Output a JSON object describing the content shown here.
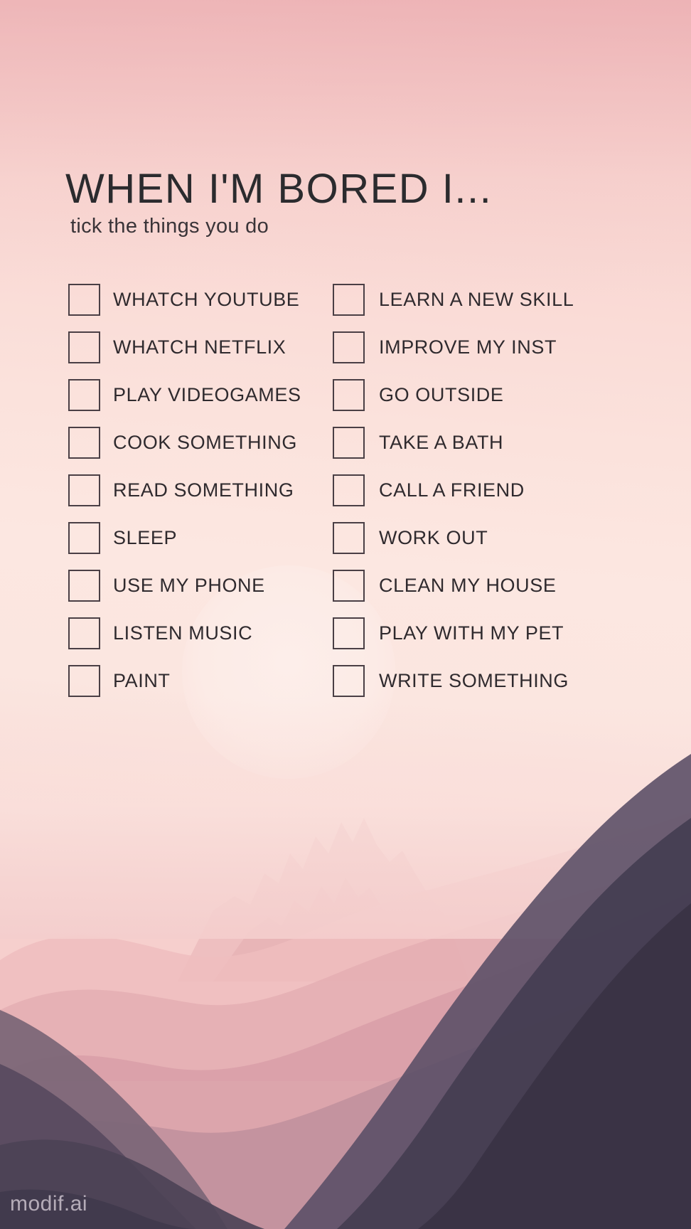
{
  "poster": {
    "title": "WHEN I'M BORED I...",
    "subtitle": "tick the things you do",
    "watermark": "modif.ai"
  },
  "colors": {
    "background_top": "#f3c4c4",
    "background_mid": "#fce7e1",
    "mountain_far": "#f0c4c4",
    "mountain_mid": "#d9a6ad",
    "mountain_near": "#6e5c6e",
    "mountain_dark": "#3b3546",
    "text": "#2f2a2e",
    "checkbox_border": "#4a3f45",
    "watermark": "#e2d8e2"
  },
  "checklist": {
    "left_column": [
      {
        "label": "WHATCH YOUTUBE",
        "checked": false
      },
      {
        "label": "WHATCH NETFLIX",
        "checked": false
      },
      {
        "label": "PLAY VIDEOGAMES",
        "checked": false
      },
      {
        "label": "COOK SOMETHING",
        "checked": false
      },
      {
        "label": "READ SOMETHING",
        "checked": false
      },
      {
        "label": "SLEEP",
        "checked": false
      },
      {
        "label": "USE MY PHONE",
        "checked": false
      },
      {
        "label": "LISTEN MUSIC",
        "checked": false
      },
      {
        "label": "PAINT",
        "checked": false
      }
    ],
    "right_column": [
      {
        "label": "LEARN A NEW SKILL",
        "checked": false
      },
      {
        "label": "IMPROVE MY INST",
        "checked": false
      },
      {
        "label": "GO OUTSIDE",
        "checked": false
      },
      {
        "label": "TAKE A BATH",
        "checked": false
      },
      {
        "label": "CALL A FRIEND",
        "checked": false
      },
      {
        "label": "WORK OUT",
        "checked": false
      },
      {
        "label": "CLEAN MY HOUSE",
        "checked": false
      },
      {
        "label": "PLAY WITH MY PET",
        "checked": false
      },
      {
        "label": "WRITE SOMETHING",
        "checked": false
      }
    ]
  }
}
